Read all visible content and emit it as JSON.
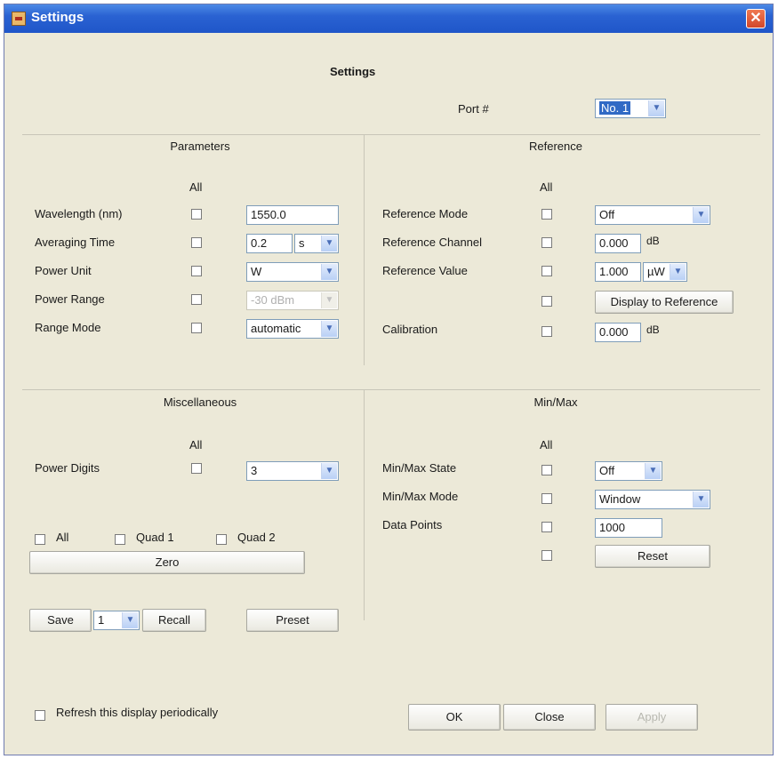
{
  "window": {
    "title": "Settings"
  },
  "heading": "Settings",
  "port": {
    "label": "Port #",
    "value": "No. 1"
  },
  "parameters": {
    "title": "Parameters",
    "all_label": "All",
    "wavelength": {
      "label": "Wavelength (nm)",
      "value": "1550.0"
    },
    "averaging_time": {
      "label": "Averaging Time",
      "value": "0.2",
      "unit": "s"
    },
    "power_unit": {
      "label": "Power Unit",
      "value": "W"
    },
    "power_range": {
      "label": "Power Range",
      "value": "-30 dBm"
    },
    "range_mode": {
      "label": "Range Mode",
      "value": "automatic"
    }
  },
  "reference": {
    "title": "Reference",
    "all_label": "All",
    "reference_mode": {
      "label": "Reference Mode",
      "value": "Off"
    },
    "reference_channel": {
      "label": "Reference Channel",
      "value": "0.000",
      "unit": "dB"
    },
    "reference_value": {
      "label": "Reference Value",
      "value": "1.000",
      "unit": "µW"
    },
    "display_to_reference": "Display to Reference",
    "calibration": {
      "label": "Calibration",
      "value": "0.000",
      "unit": "dB"
    }
  },
  "miscellaneous": {
    "title": "Miscellaneous",
    "all_label": "All",
    "power_digits": {
      "label": "Power Digits",
      "value": "3"
    },
    "quad_all": "All",
    "quad_1": "Quad 1",
    "quad_2": "Quad 2",
    "zero": "Zero",
    "save": "Save",
    "slot": "1",
    "recall": "Recall",
    "preset": "Preset"
  },
  "minmax": {
    "title": "Min/Max",
    "all_label": "All",
    "state": {
      "label": "Min/Max State",
      "value": "Off"
    },
    "mode": {
      "label": "Min/Max Mode",
      "value": "Window"
    },
    "data_points": {
      "label": "Data Points",
      "value": "1000"
    },
    "reset": "Reset"
  },
  "footer": {
    "refresh": "Refresh this display periodically",
    "ok": "OK",
    "close": "Close",
    "apply": "Apply"
  },
  "colors": {
    "titlebar": "#2a62d2",
    "window": "#ece9d8",
    "close": "#d2462a"
  }
}
